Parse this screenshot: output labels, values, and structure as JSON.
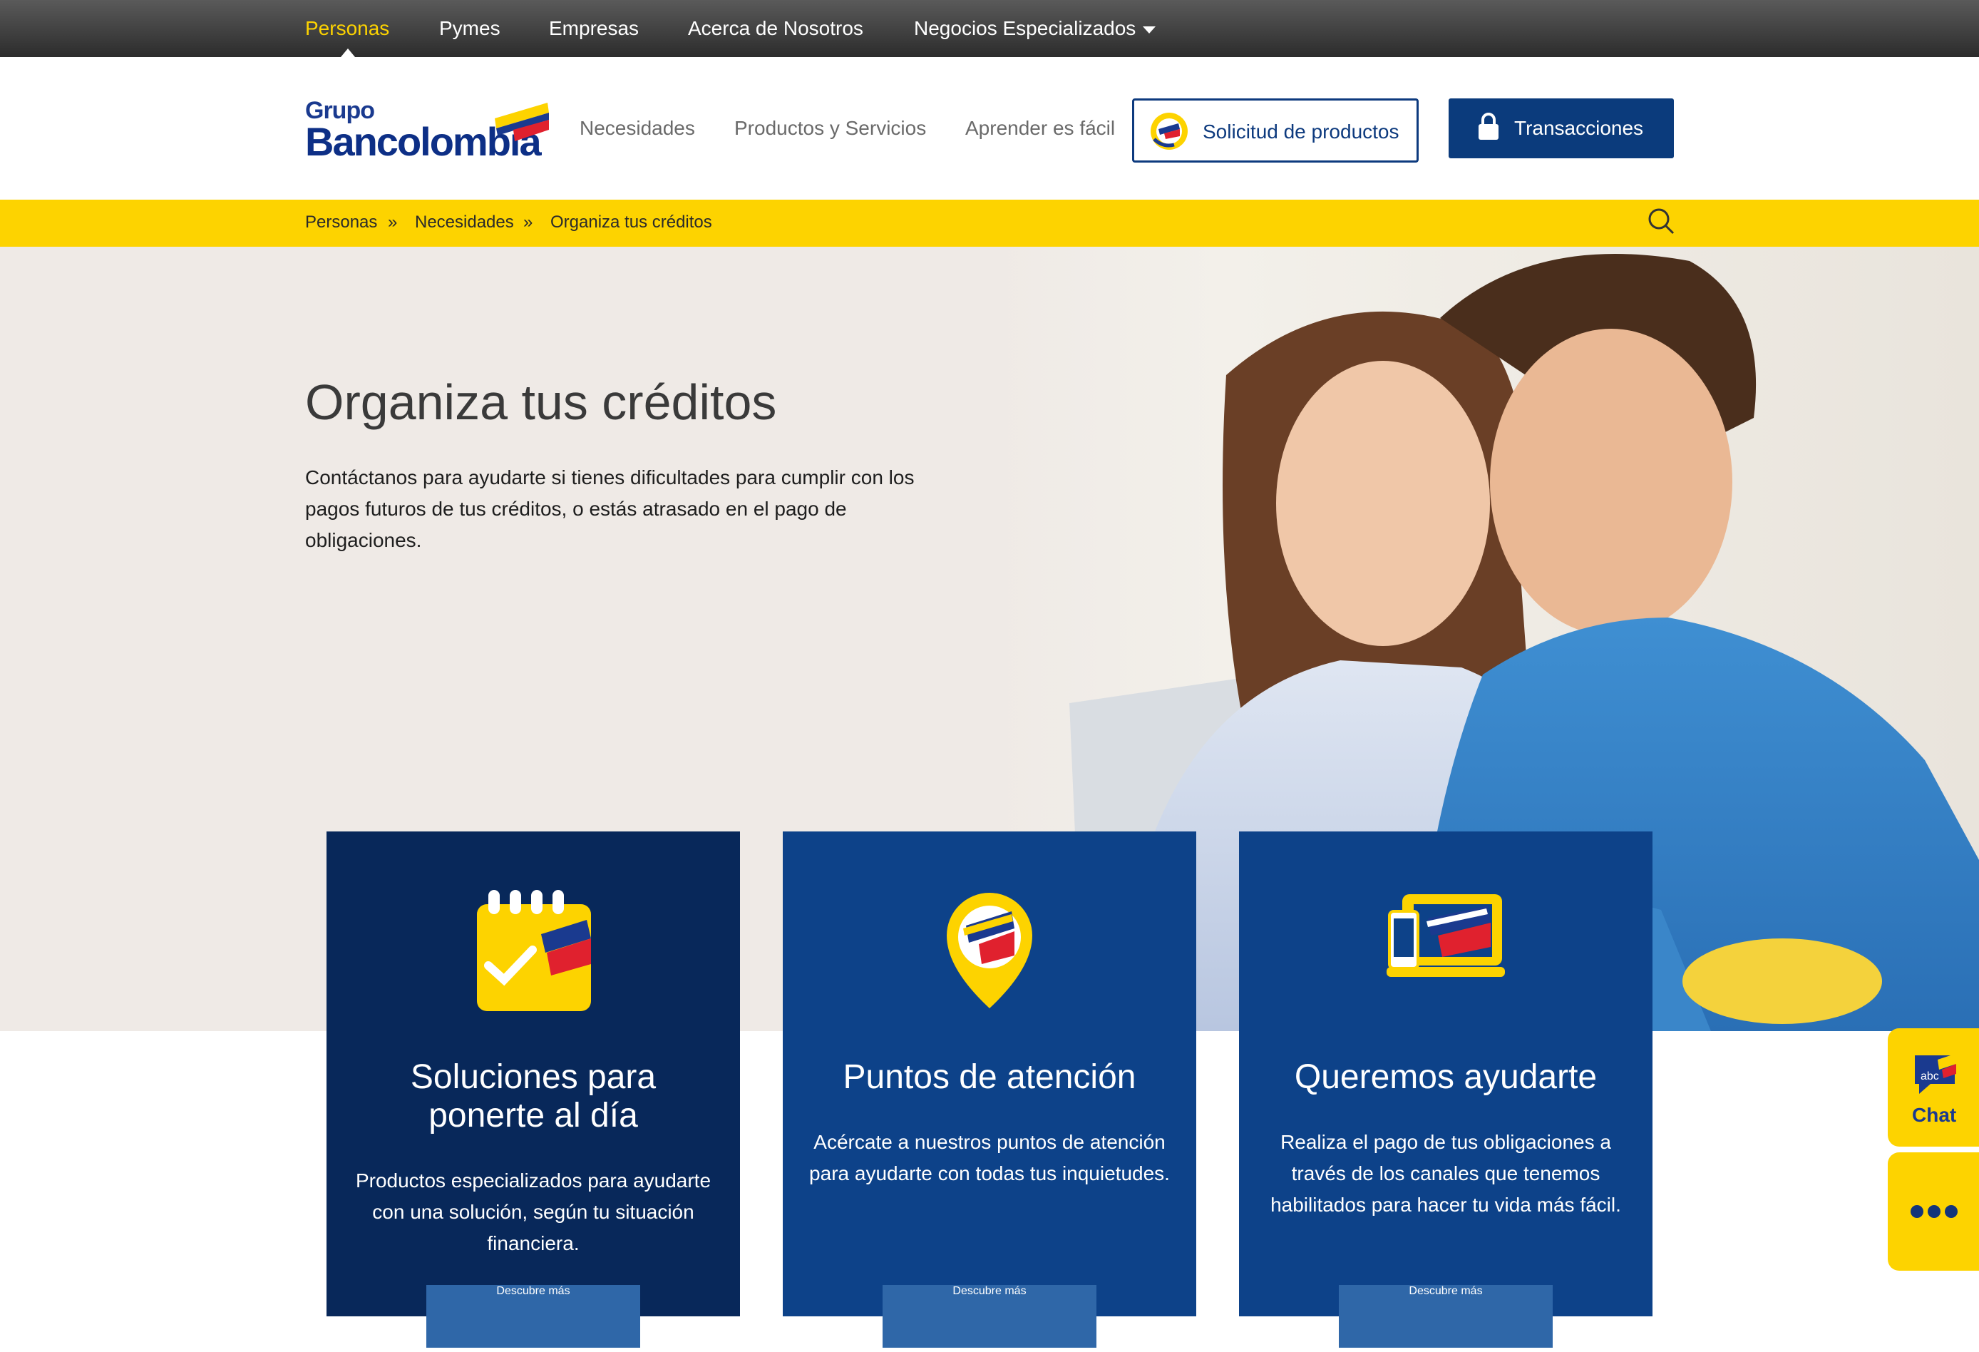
{
  "topnav": {
    "items": [
      "Personas",
      "Pymes",
      "Empresas",
      "Acerca de Nosotros",
      "Negocios Especializados"
    ]
  },
  "header": {
    "logo_line1": "Grupo",
    "logo_line2": "Bancolombia",
    "nav": [
      "Necesidades",
      "Productos y Servicios",
      "Aprender es fácil"
    ],
    "solicitud_label": "Solicitud de productos",
    "transacciones_label": "Transacciones"
  },
  "breadcrumb": {
    "items": [
      "Personas",
      "Necesidades",
      "Organiza tus créditos"
    ],
    "separator": "»"
  },
  "hero": {
    "title": "Organiza tus créditos",
    "text": "Contáctanos para ayudarte si tienes dificultades para cumplir con los pagos futuros de tus créditos, o estás atrasado en el pago de obligaciones."
  },
  "cards": [
    {
      "title": "Soluciones para ponerte al día",
      "text": "Productos especializados para ayudarte con una solución, según tu situación financiera.",
      "button": "Descubre más",
      "icon": "calendar-check-icon"
    },
    {
      "title": "Puntos de atención",
      "text": "Acércate a nuestros puntos de atención para ayudarte con todas tus inquietudes.",
      "button": "Descubre más",
      "icon": "location-pin-icon"
    },
    {
      "title": "Queremos ayudarte",
      "text": "Realiza el pago de tus obligaciones a través de los canales que tenemos habilitados para hacer tu vida más fácil.",
      "button": "Descubre más",
      "icon": "devices-icon"
    }
  ],
  "side": {
    "chat_label": "Chat",
    "chat_badge": "abc"
  },
  "colors": {
    "brand_yellow": "#fdd300",
    "brand_blue": "#0b3b7c",
    "card_dark": "#08285a",
    "card_mid": "#0d4289",
    "topbar": "#3a3a3a",
    "active_nav": "#fdd300"
  }
}
